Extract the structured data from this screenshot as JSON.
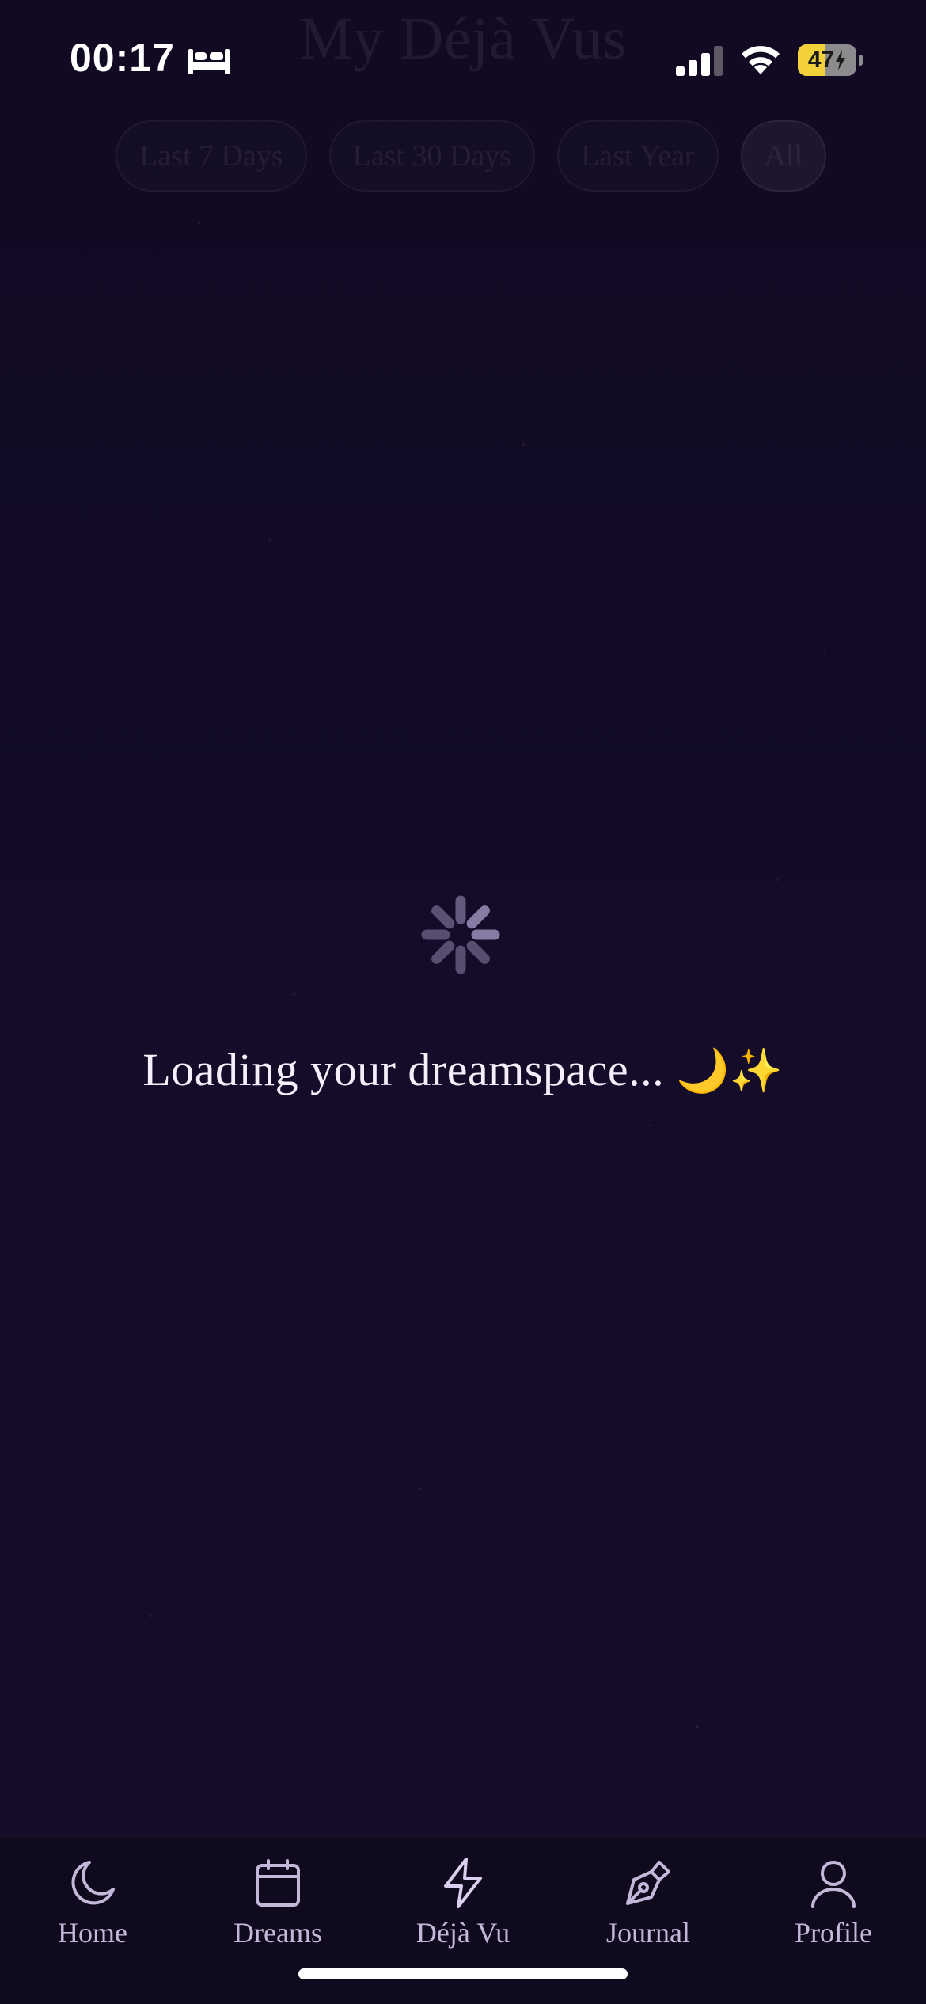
{
  "status_bar": {
    "time": "00:17",
    "battery_level": "47",
    "icons": [
      "bed-icon",
      "cellular-signal-icon",
      "wifi-icon",
      "battery-charging-icon"
    ]
  },
  "header": {
    "title": "My Déjà Vus"
  },
  "filters": [
    {
      "label": "Last 7 Days",
      "active": false
    },
    {
      "label": "Last 30 Days",
      "active": false
    },
    {
      "label": "Last Year",
      "active": false
    },
    {
      "label": "All",
      "active": true
    }
  ],
  "loader": {
    "message": "Loading your dreamspace...",
    "emoji_moon": "🌙",
    "emoji_sparkles": "✨"
  },
  "tabs": [
    {
      "label": "Home",
      "icon": "moon-icon"
    },
    {
      "label": "Dreams",
      "icon": "calendar-icon"
    },
    {
      "label": "Déjà Vu",
      "icon": "lightning-icon"
    },
    {
      "label": "Journal",
      "icon": "pen-nib-icon"
    },
    {
      "label": "Profile",
      "icon": "user-icon"
    }
  ],
  "colors": {
    "background": "#120b24",
    "tab_bar": "#0f0a1d",
    "tab_icon": "#c2b8d9",
    "battery_fill": "#f2d13b"
  }
}
